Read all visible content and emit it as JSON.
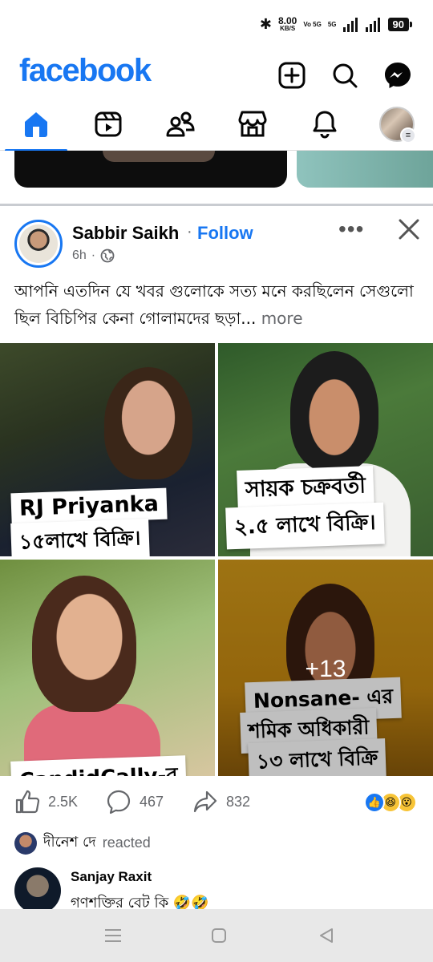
{
  "status": {
    "speed": "8.00",
    "speed_unit": "KB/S",
    "net1": "Vo 5G",
    "net2": "5G",
    "battery": "90"
  },
  "header": {
    "logo": "facebook",
    "icons": [
      "add-icon",
      "search-icon",
      "messenger-icon"
    ]
  },
  "tabs": [
    {
      "name": "home",
      "active": true
    },
    {
      "name": "video"
    },
    {
      "name": "friends"
    },
    {
      "name": "marketplace"
    },
    {
      "name": "notifications"
    },
    {
      "name": "profile-menu"
    }
  ],
  "post": {
    "author": "Sabbir Saikh",
    "separator": "·",
    "follow_label": "Follow",
    "time": "6h",
    "privacy_icon": "globe-icon",
    "text": "আপনি এতদিন যে খবর গুলোকে সত্য মনে করছিলেন সেগুলো ছিল বিচিপির কেনা গোলামদের ছড়া...",
    "more_label": "more",
    "images": [
      {
        "caption1": "RJ Priyanka",
        "caption2": "১৫লাখে বিক্রি।"
      },
      {
        "caption1": "সায়ক চক্রবর্তী",
        "caption2": "২.৫ লাখে বিক্রি।"
      },
      {
        "caption1": "CandidCally-র"
      },
      {
        "caption1": "Nonsane- এর",
        "caption2": "শমিক অধিকারী",
        "caption3": "১৩ লাখে বিক্রি",
        "overlay": "+13"
      }
    ],
    "stats": {
      "likes": "2.5K",
      "comments": "467",
      "shares": "832"
    },
    "reacted_name": "দীনেশ দে",
    "reacted_label": "reacted",
    "comment": {
      "author": "Sanjay Raxit",
      "text": "গণশক্তির বেট কি 🤣🤣"
    }
  },
  "colors": {
    "brand": "#1877F2",
    "secondary_text": "#65676b"
  }
}
